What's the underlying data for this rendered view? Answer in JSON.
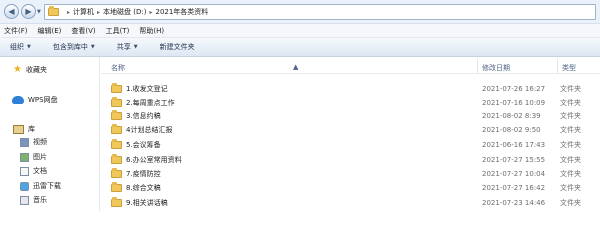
{
  "address": {
    "crumbs": [
      "计算机",
      "本地磁盘 (D:)",
      "2021年各类资料"
    ],
    "separator": "▸"
  },
  "menu": [
    "文件(F)",
    "编辑(E)",
    "查看(V)",
    "工具(T)",
    "帮助(H)"
  ],
  "toolbar": [
    {
      "label": "组织",
      "dropdown": true
    },
    {
      "label": "包含到库中",
      "dropdown": true
    },
    {
      "label": "共享",
      "dropdown": true
    },
    {
      "label": "新建文件夹",
      "dropdown": false
    }
  ],
  "nav": {
    "favorites": "收藏夹",
    "wps": "WPS网盘",
    "library": "库",
    "library_items": [
      "视频",
      "图片",
      "文档",
      "迅雷下载",
      "音乐"
    ]
  },
  "columns": {
    "name": "名称",
    "date": "修改日期",
    "type": "类型"
  },
  "files": [
    {
      "name": "1.收发文登记",
      "date": "2021-07-26 16:27",
      "type": "文件夹"
    },
    {
      "name": "2.每周重点工作",
      "date": "2021-07-16 10:09",
      "type": "文件夹"
    },
    {
      "name": "3.信息约稿",
      "date": "2021-08-02 8:39",
      "type": "文件夹"
    },
    {
      "name": "4计划总结汇报",
      "date": "2021-08-02 9:50",
      "type": "文件夹"
    },
    {
      "name": "5.会议筹备",
      "date": "2021-06-16 17:43",
      "type": "文件夹"
    },
    {
      "name": "6.办公室常用资料",
      "date": "2021-07-27 15:55",
      "type": "文件夹"
    },
    {
      "name": "7.疫情防控",
      "date": "2021-07-27 10:04",
      "type": "文件夹"
    },
    {
      "name": "8.综合文稿",
      "date": "2021-07-27 16:42",
      "type": "文件夹"
    },
    {
      "name": "9.相关讲话稿",
      "date": "2021-07-23 14:46",
      "type": "文件夹"
    }
  ]
}
